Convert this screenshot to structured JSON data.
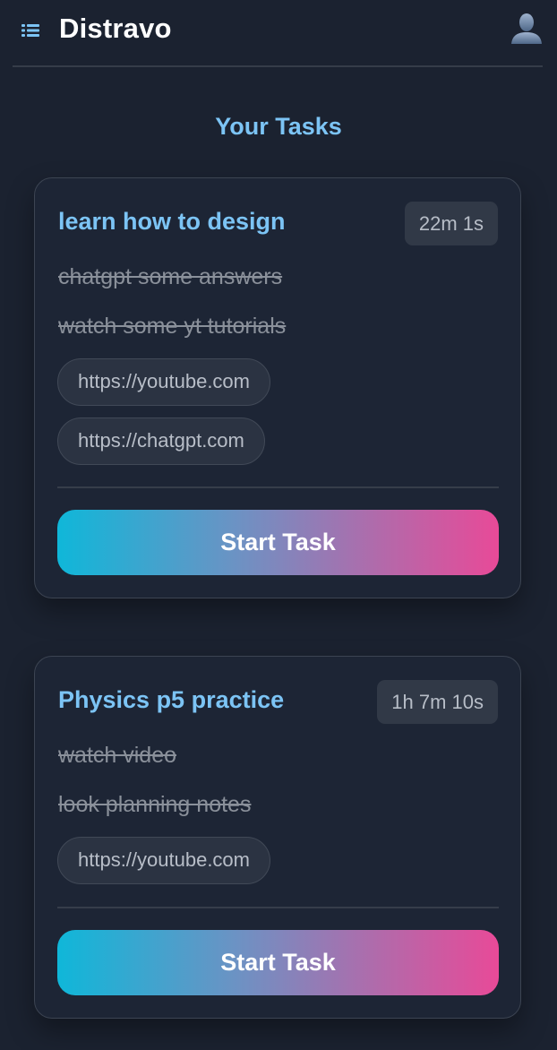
{
  "app": {
    "title": "Distravo"
  },
  "icons": {
    "menu": "list-menu-icon",
    "profile": "user-avatar-icon"
  },
  "section_title": "Your Tasks",
  "colors": {
    "background": "#1b2230",
    "card_background": "#1d2535",
    "accent_blue": "#7cc4f5",
    "button_gradient_start": "#0fb7d9",
    "button_gradient_end": "#e84a98"
  },
  "tasks": [
    {
      "title": "learn how to design",
      "time": "22m 1s",
      "subtasks": [
        "chatgpt some answers",
        "watch some yt tutorials"
      ],
      "links": [
        "https://youtube.com",
        "https://chatgpt.com"
      ],
      "button_label": "Start Task"
    },
    {
      "title": "Physics p5 practice",
      "time": "1h 7m 10s",
      "subtasks": [
        "watch video",
        "look planning notes"
      ],
      "links": [
        "https://youtube.com"
      ],
      "button_label": "Start Task"
    }
  ]
}
